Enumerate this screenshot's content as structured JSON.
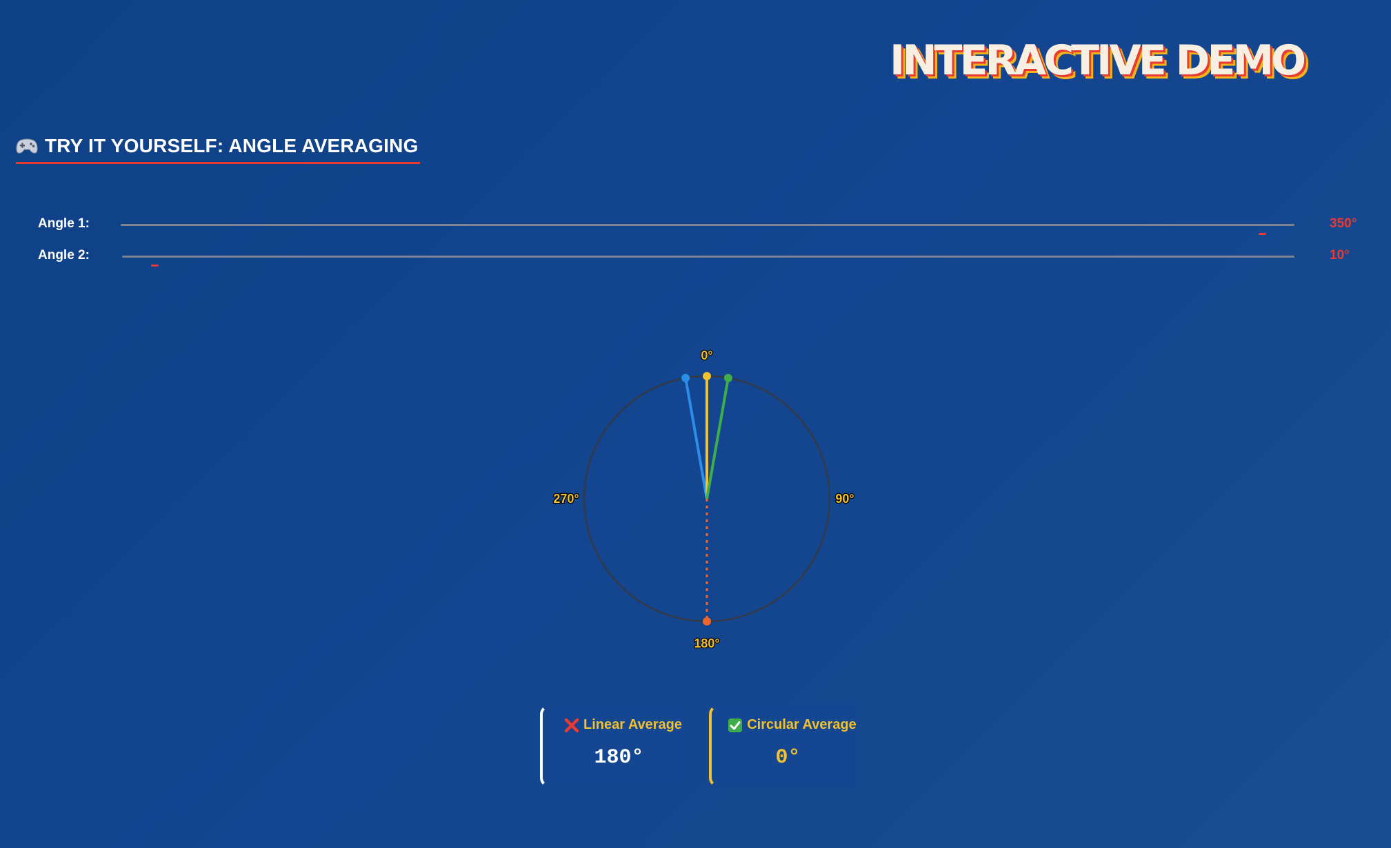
{
  "header": {
    "title": "INTERACTIVE DEMO"
  },
  "section": {
    "icon": "gamepad-icon",
    "heading": "TRY IT YOURSELF: ANGLE AVERAGING"
  },
  "sliders": [
    {
      "label": "Angle 1:",
      "value": 350,
      "value_text": "350°",
      "min": 0,
      "max": 360
    },
    {
      "label": "Angle 2:",
      "value": 10,
      "value_text": "10°",
      "min": 0,
      "max": 360
    }
  ],
  "dial": {
    "labels": {
      "top": "0°",
      "right": "90°",
      "bottom": "180°",
      "left": "270°"
    },
    "vectors": [
      {
        "name": "angle-1",
        "angle": 350,
        "color": "#2a8ee6"
      },
      {
        "name": "circular-average",
        "angle": 0,
        "color": "#f2c12e"
      },
      {
        "name": "angle-2",
        "angle": 10,
        "color": "#3fae4a"
      },
      {
        "name": "linear-average",
        "angle": 180,
        "color": "#f0662a",
        "dashed": true
      }
    ]
  },
  "results": {
    "linear": {
      "icon": "cross-mark-icon",
      "label": "Linear Average",
      "value": "180°",
      "accent": "#ffffff"
    },
    "circular": {
      "icon": "check-mark-icon",
      "label": "Circular Average",
      "value": "0°",
      "accent": "#f2c12e"
    }
  },
  "colors": {
    "accent_red": "#e63a33",
    "accent_yellow": "#f2c12e",
    "background": "#134590"
  }
}
